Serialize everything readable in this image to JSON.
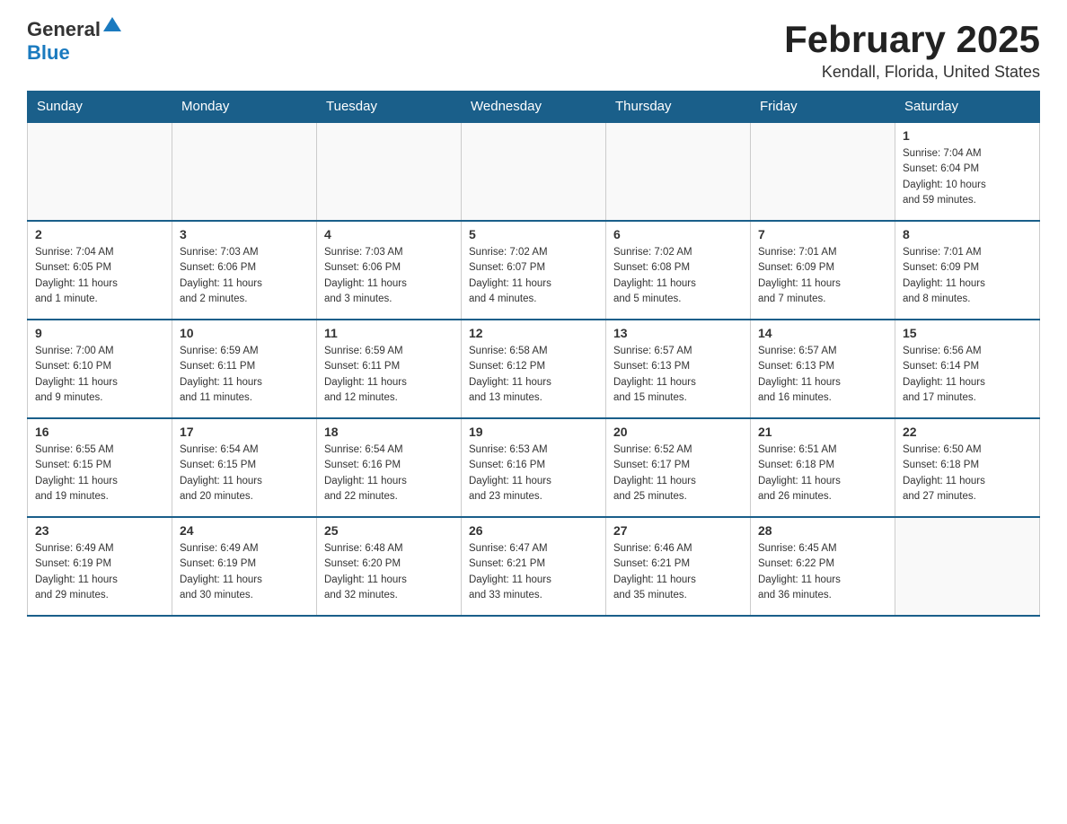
{
  "header": {
    "logo_general": "General",
    "logo_blue": "Blue",
    "month_title": "February 2025",
    "location": "Kendall, Florida, United States"
  },
  "weekdays": [
    "Sunday",
    "Monday",
    "Tuesday",
    "Wednesday",
    "Thursday",
    "Friday",
    "Saturday"
  ],
  "weeks": [
    [
      {
        "day": "",
        "info": ""
      },
      {
        "day": "",
        "info": ""
      },
      {
        "day": "",
        "info": ""
      },
      {
        "day": "",
        "info": ""
      },
      {
        "day": "",
        "info": ""
      },
      {
        "day": "",
        "info": ""
      },
      {
        "day": "1",
        "info": "Sunrise: 7:04 AM\nSunset: 6:04 PM\nDaylight: 10 hours\nand 59 minutes."
      }
    ],
    [
      {
        "day": "2",
        "info": "Sunrise: 7:04 AM\nSunset: 6:05 PM\nDaylight: 11 hours\nand 1 minute."
      },
      {
        "day": "3",
        "info": "Sunrise: 7:03 AM\nSunset: 6:06 PM\nDaylight: 11 hours\nand 2 minutes."
      },
      {
        "day": "4",
        "info": "Sunrise: 7:03 AM\nSunset: 6:06 PM\nDaylight: 11 hours\nand 3 minutes."
      },
      {
        "day": "5",
        "info": "Sunrise: 7:02 AM\nSunset: 6:07 PM\nDaylight: 11 hours\nand 4 minutes."
      },
      {
        "day": "6",
        "info": "Sunrise: 7:02 AM\nSunset: 6:08 PM\nDaylight: 11 hours\nand 5 minutes."
      },
      {
        "day": "7",
        "info": "Sunrise: 7:01 AM\nSunset: 6:09 PM\nDaylight: 11 hours\nand 7 minutes."
      },
      {
        "day": "8",
        "info": "Sunrise: 7:01 AM\nSunset: 6:09 PM\nDaylight: 11 hours\nand 8 minutes."
      }
    ],
    [
      {
        "day": "9",
        "info": "Sunrise: 7:00 AM\nSunset: 6:10 PM\nDaylight: 11 hours\nand 9 minutes."
      },
      {
        "day": "10",
        "info": "Sunrise: 6:59 AM\nSunset: 6:11 PM\nDaylight: 11 hours\nand 11 minutes."
      },
      {
        "day": "11",
        "info": "Sunrise: 6:59 AM\nSunset: 6:11 PM\nDaylight: 11 hours\nand 12 minutes."
      },
      {
        "day": "12",
        "info": "Sunrise: 6:58 AM\nSunset: 6:12 PM\nDaylight: 11 hours\nand 13 minutes."
      },
      {
        "day": "13",
        "info": "Sunrise: 6:57 AM\nSunset: 6:13 PM\nDaylight: 11 hours\nand 15 minutes."
      },
      {
        "day": "14",
        "info": "Sunrise: 6:57 AM\nSunset: 6:13 PM\nDaylight: 11 hours\nand 16 minutes."
      },
      {
        "day": "15",
        "info": "Sunrise: 6:56 AM\nSunset: 6:14 PM\nDaylight: 11 hours\nand 17 minutes."
      }
    ],
    [
      {
        "day": "16",
        "info": "Sunrise: 6:55 AM\nSunset: 6:15 PM\nDaylight: 11 hours\nand 19 minutes."
      },
      {
        "day": "17",
        "info": "Sunrise: 6:54 AM\nSunset: 6:15 PM\nDaylight: 11 hours\nand 20 minutes."
      },
      {
        "day": "18",
        "info": "Sunrise: 6:54 AM\nSunset: 6:16 PM\nDaylight: 11 hours\nand 22 minutes."
      },
      {
        "day": "19",
        "info": "Sunrise: 6:53 AM\nSunset: 6:16 PM\nDaylight: 11 hours\nand 23 minutes."
      },
      {
        "day": "20",
        "info": "Sunrise: 6:52 AM\nSunset: 6:17 PM\nDaylight: 11 hours\nand 25 minutes."
      },
      {
        "day": "21",
        "info": "Sunrise: 6:51 AM\nSunset: 6:18 PM\nDaylight: 11 hours\nand 26 minutes."
      },
      {
        "day": "22",
        "info": "Sunrise: 6:50 AM\nSunset: 6:18 PM\nDaylight: 11 hours\nand 27 minutes."
      }
    ],
    [
      {
        "day": "23",
        "info": "Sunrise: 6:49 AM\nSunset: 6:19 PM\nDaylight: 11 hours\nand 29 minutes."
      },
      {
        "day": "24",
        "info": "Sunrise: 6:49 AM\nSunset: 6:19 PM\nDaylight: 11 hours\nand 30 minutes."
      },
      {
        "day": "25",
        "info": "Sunrise: 6:48 AM\nSunset: 6:20 PM\nDaylight: 11 hours\nand 32 minutes."
      },
      {
        "day": "26",
        "info": "Sunrise: 6:47 AM\nSunset: 6:21 PM\nDaylight: 11 hours\nand 33 minutes."
      },
      {
        "day": "27",
        "info": "Sunrise: 6:46 AM\nSunset: 6:21 PM\nDaylight: 11 hours\nand 35 minutes."
      },
      {
        "day": "28",
        "info": "Sunrise: 6:45 AM\nSunset: 6:22 PM\nDaylight: 11 hours\nand 36 minutes."
      },
      {
        "day": "",
        "info": ""
      }
    ]
  ]
}
